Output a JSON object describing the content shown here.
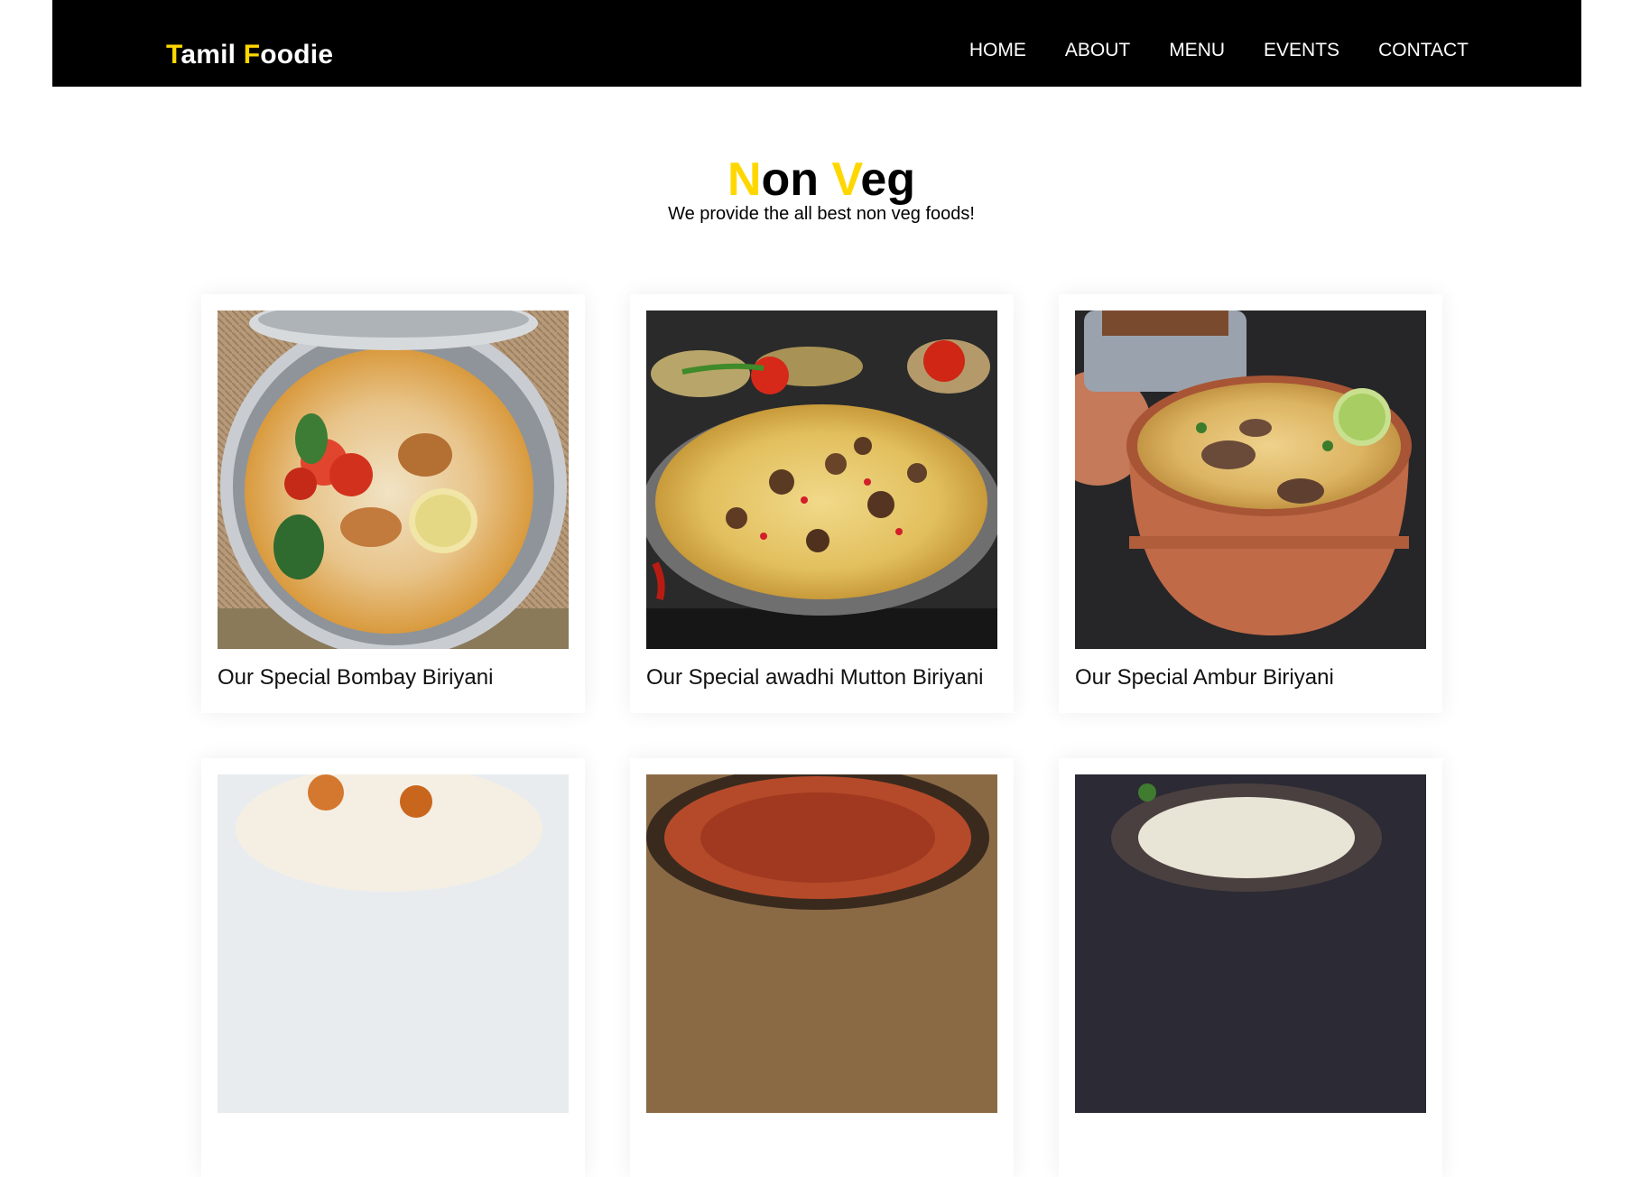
{
  "brand": {
    "first_letter": "T",
    "first_rest": "amil ",
    "second_letter": "F",
    "second_rest": "oodie"
  },
  "nav": {
    "items": [
      "HOME",
      "ABOUT",
      "MENU",
      "EVENTS",
      "CONTACT"
    ]
  },
  "section": {
    "title_n": "N",
    "title_on": "on ",
    "title_v": "V",
    "title_eg": "eg",
    "subtitle": "We provide the all best non veg foods!"
  },
  "cards": [
    {
      "caption": "Our Special Bombay Biriyani",
      "image": "biryani-steel-bowl"
    },
    {
      "caption": "Our Special awadhi Mutton Biriyani",
      "image": "mutton-biryani-plate"
    },
    {
      "caption": "Our Special Ambur Biriyani",
      "image": "biryani-clay-pot"
    },
    {
      "caption": "",
      "image": "biryani-partial-4"
    },
    {
      "caption": "",
      "image": "biryani-partial-5"
    },
    {
      "caption": "",
      "image": "biryani-partial-6"
    }
  ],
  "colors": {
    "accent": "#ffd700",
    "navbar_bg": "#000000",
    "text": "#000000"
  }
}
